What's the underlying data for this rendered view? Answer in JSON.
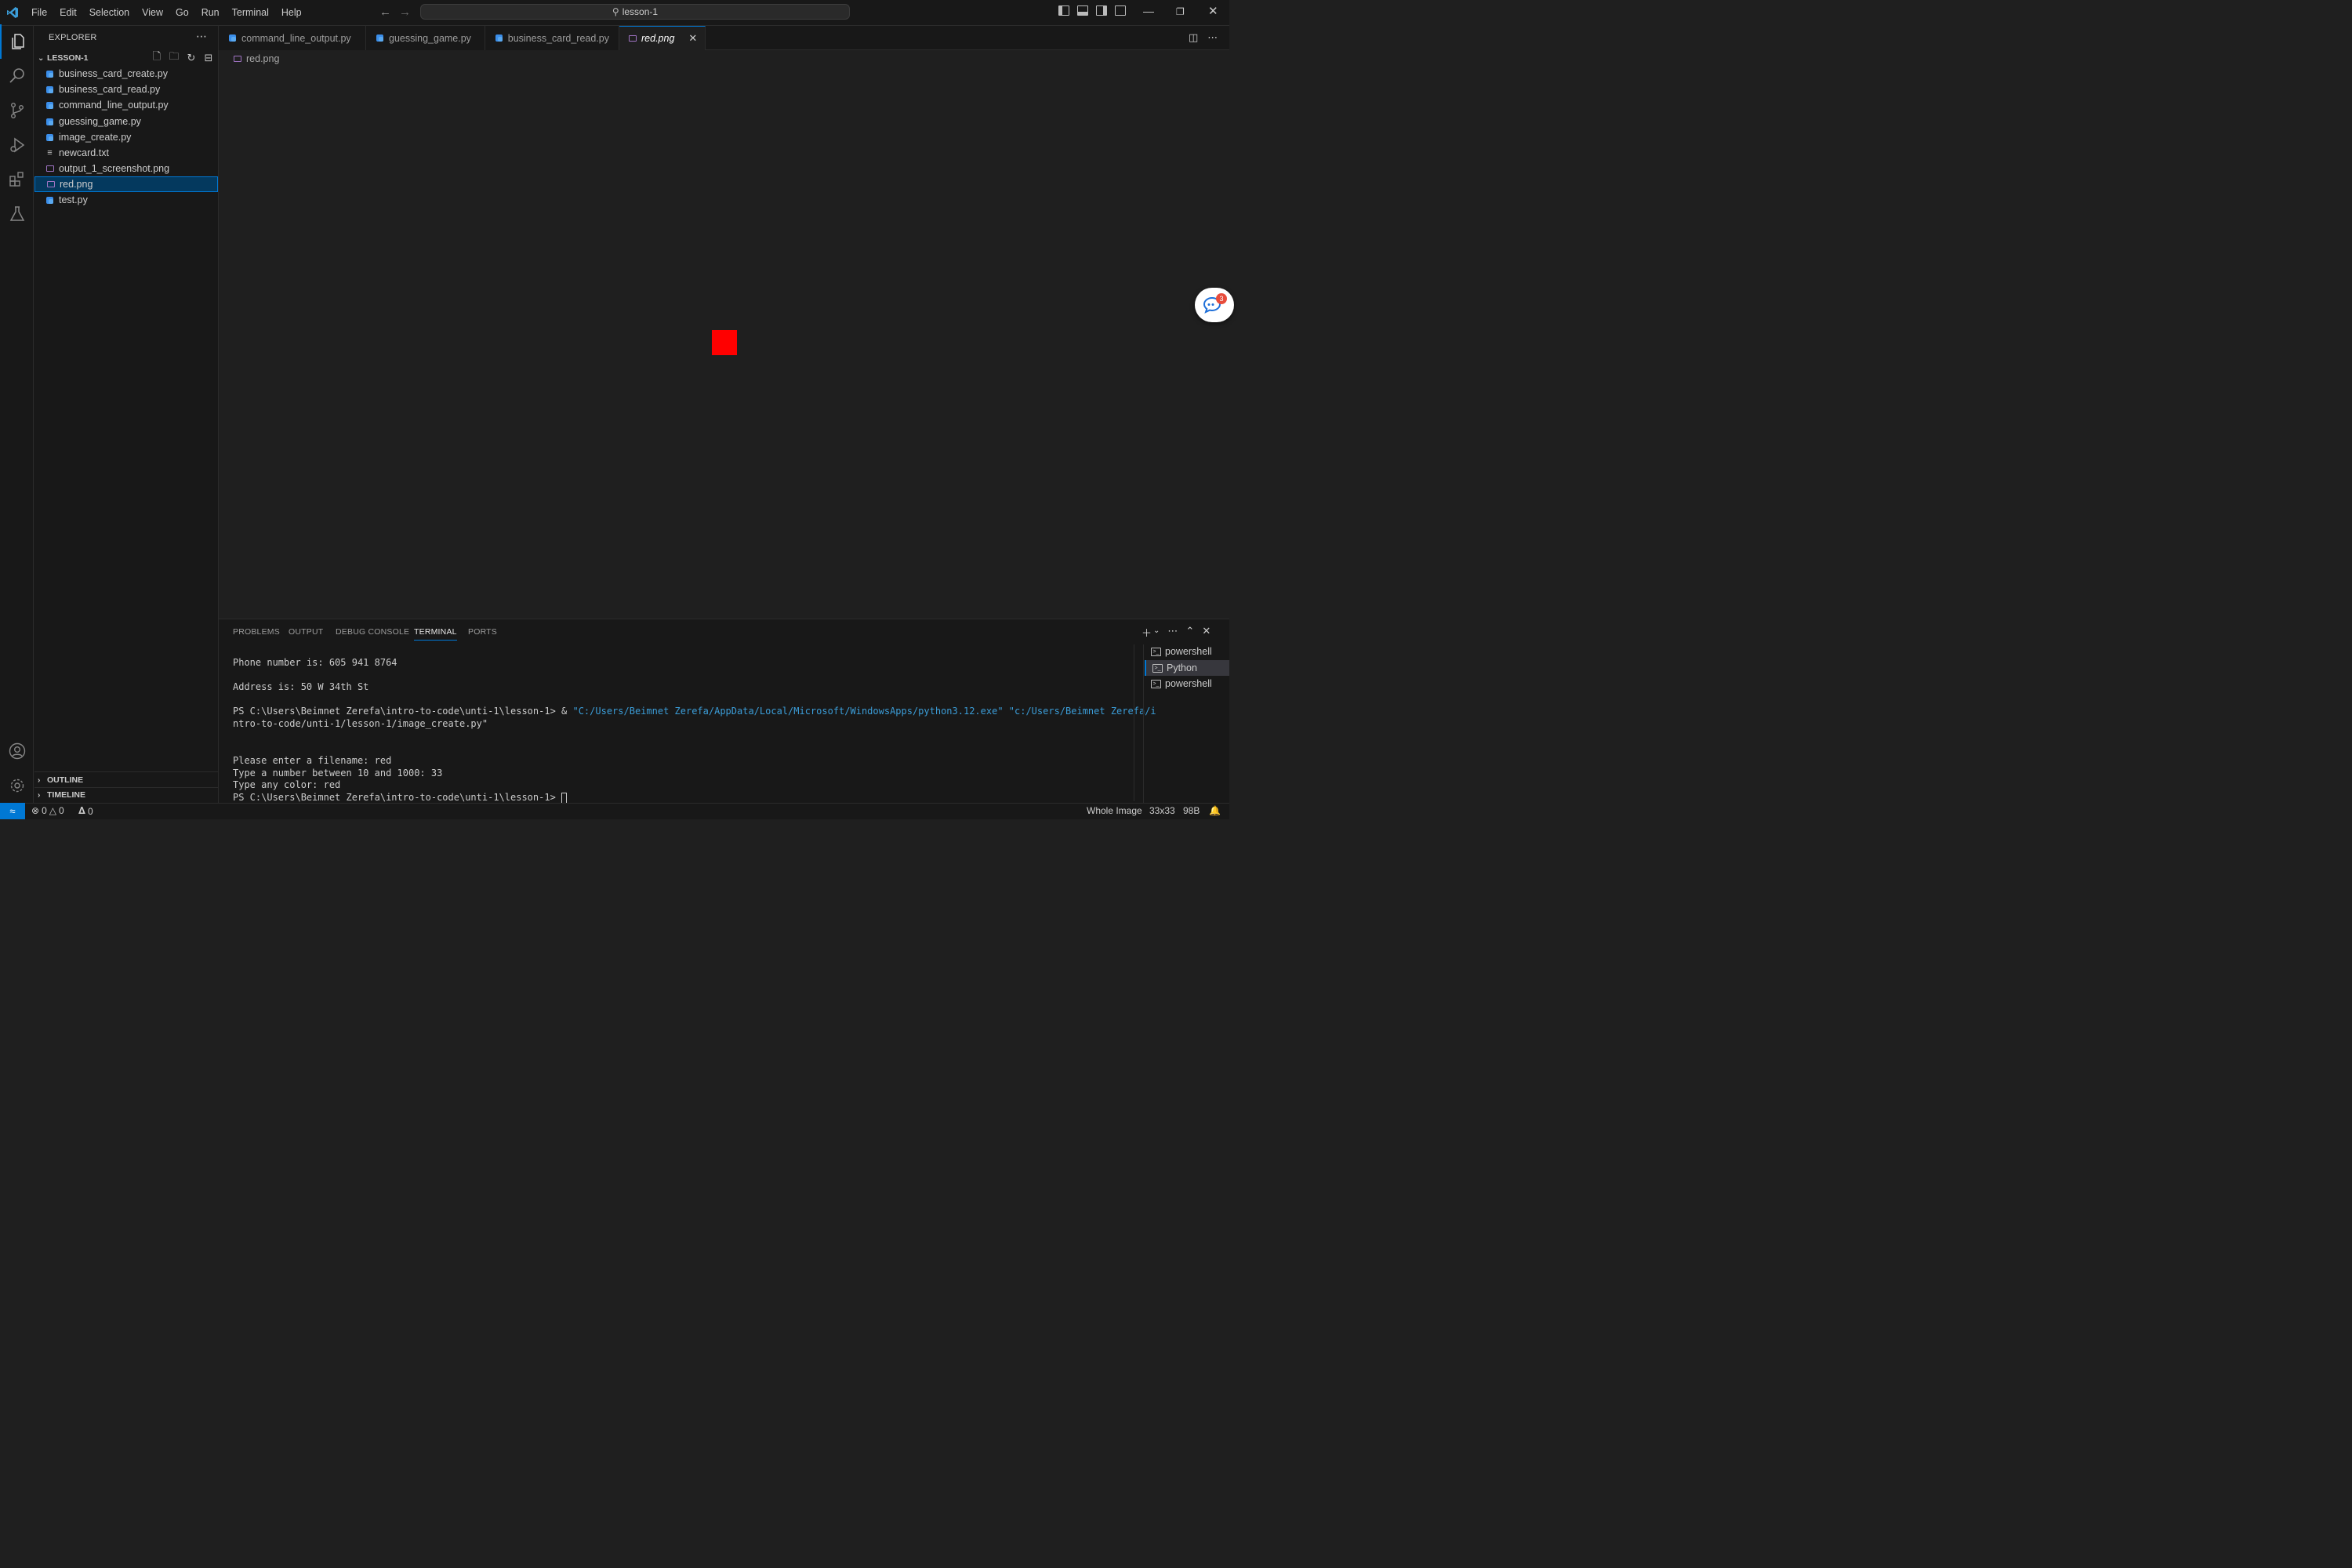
{
  "titlebar": {
    "menu": [
      "File",
      "Edit",
      "Selection",
      "View",
      "Go",
      "Run",
      "Terminal",
      "Help"
    ],
    "search_text": "lesson-1"
  },
  "explorer": {
    "title": "EXPLORER",
    "project": "LESSON-1",
    "files": [
      {
        "name": "business_card_create.py",
        "type": "py"
      },
      {
        "name": "business_card_read.py",
        "type": "py"
      },
      {
        "name": "command_line_output.py",
        "type": "py"
      },
      {
        "name": "guessing_game.py",
        "type": "py"
      },
      {
        "name": "image_create.py",
        "type": "py"
      },
      {
        "name": "newcard.txt",
        "type": "txt"
      },
      {
        "name": "output_1_screenshot.png",
        "type": "img"
      },
      {
        "name": "red.png",
        "type": "img",
        "selected": true
      },
      {
        "name": "test.py",
        "type": "py"
      }
    ],
    "outline": "OUTLINE",
    "timeline": "TIMELINE"
  },
  "tabs": [
    {
      "label": "command_line_output.py",
      "type": "py"
    },
    {
      "label": "guessing_game.py",
      "type": "py"
    },
    {
      "label": "business_card_read.py",
      "type": "py"
    },
    {
      "label": "red.png",
      "type": "img",
      "active": true
    }
  ],
  "breadcrumb": "red.png",
  "image_color": "#ff0000",
  "copilot_badge": "3",
  "panel": {
    "tabs": [
      "PROBLEMS",
      "OUTPUT",
      "DEBUG CONSOLE",
      "TERMINAL",
      "PORTS"
    ],
    "active_tab": "TERMINAL",
    "terminal": {
      "line1": "Phone number is: 605 941 8764",
      "line2": "Address is: 50 W 34th St",
      "line3_prompt": "PS C:\\Users\\Beimnet Zerefa\\intro-to-code\\unti-1\\lesson-1> & ",
      "line3_cmd": "\"C:/Users/Beimnet Zerefa/AppData/Local/Microsoft/WindowsApps/python3.12.exe\" \"c:/Users/Beimnet Zerefa/i",
      "line4_cmd": "ntro-to-code/unti-1/lesson-1/image_create.py\"",
      "line5": "Please enter a filename: red",
      "line6": "Type a number between 10 and 1000: 33",
      "line7": "Type any color: red",
      "line8": "PS C:\\Users\\Beimnet Zerefa\\intro-to-code\\unti-1\\lesson-1> "
    },
    "terminals": [
      "powershell",
      "Python",
      "powershell"
    ]
  },
  "statusbar": {
    "errors": "0",
    "warnings": "0",
    "ports": "0",
    "zoom": "Whole Image",
    "size": "33x33",
    "filesize": "98B"
  }
}
